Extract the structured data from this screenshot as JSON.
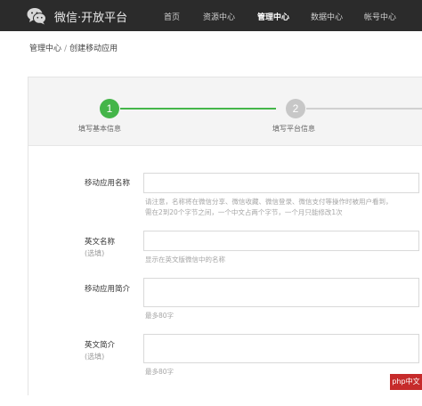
{
  "header": {
    "brand": "微信·开放平台",
    "nav": [
      "首页",
      "资源中心",
      "管理中心",
      "数据中心",
      "帐号中心"
    ],
    "active_nav": "管理中心"
  },
  "breadcrumb": {
    "root": "管理中心",
    "separator": "/",
    "current": "创建移动应用"
  },
  "steps": [
    {
      "number": "1",
      "label": "填写基本信息",
      "state": "done"
    },
    {
      "number": "2",
      "label": "填写平台信息",
      "state": "todo"
    }
  ],
  "form": {
    "app_name": {
      "label": "移动应用名称",
      "value": "",
      "hint_line1": "请注意，名称将在微信分享、微信收藏、微信登录、微信支付等操作时被用户看到，",
      "hint_line2": "需在2到20个字节之间，一个中文占两个字节，一个月只能修改1次"
    },
    "english_name": {
      "label": "英文名称",
      "optional": "(选填)",
      "value": "",
      "hint": "显示在英文版微信中的名称"
    },
    "app_intro": {
      "label": "移动应用简介",
      "value": "",
      "hint": "最多80字"
    },
    "english_intro": {
      "label": "英文简介",
      "optional": "(选填)",
      "value": "",
      "hint": "最多80字"
    }
  },
  "watermark": "php中文网",
  "colors": {
    "topbar": "#2b2b2b",
    "step_done": "#44b549",
    "step_todo": "#c7c7c7"
  }
}
